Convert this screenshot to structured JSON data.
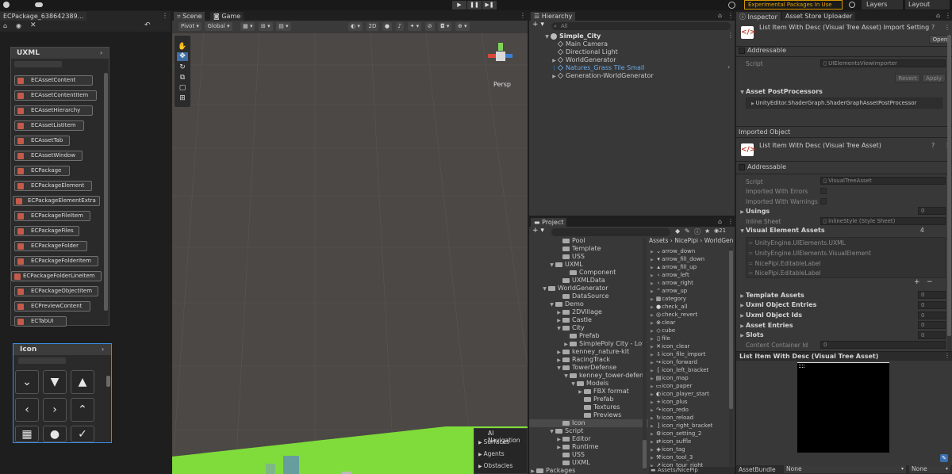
{
  "topbar": {
    "account_label": "",
    "play_icon": "play-icon",
    "pause_icon": "pause-icon",
    "step_icon": "step-icon",
    "experimental_label": "Experimental Packages In Use",
    "layers_label": "Layers",
    "layout_label": "Layout"
  },
  "left_window": {
    "tab_title": "ECPackage_638642389...",
    "uxml": {
      "title": "UXML",
      "items": [
        "ECAssetContent",
        "ECAssetContentItem",
        "ECAssetHierarchy",
        "ECAssetListItem",
        "ECAssetTab",
        "ECAssetWindow",
        "ECPackage",
        "ECPackageElement",
        "ECPackageElementExtra",
        "ECPackageFileItem",
        "ECPackageFiles",
        "ECPackageFolder",
        "ECPackageFolderItem",
        "ECPackageFolderLineItem",
        "ECPackageObjectItem",
        "ECPreviewContent",
        "ECTabUI"
      ]
    },
    "icon": {
      "title": "Icon",
      "buttons": [
        "chevron-down-icon",
        "triangle-down-icon",
        "triangle-up-icon",
        "chevron-left-icon",
        "chevron-right-icon",
        "chevron-up-icon",
        "grid-icon",
        "check-circle-filled-icon",
        "check-circle-outline-icon"
      ]
    }
  },
  "scene": {
    "tabs": [
      "Scene",
      "Game"
    ],
    "toolbar": {
      "pivot": "Pivot",
      "global": "Global",
      "mode_2d": "2D"
    },
    "persp_label": "Persp",
    "ai_nav": {
      "title": "AI Navigation",
      "items": [
        "Surfaces",
        "Agents",
        "Obstacles"
      ]
    }
  },
  "hierarchy": {
    "tab": "Hierarchy",
    "search_placeholder": "All",
    "scene_name": "Simple_City",
    "items": [
      "Main Camera",
      "Directional Light",
      "WorldGenerator",
      "Natures_Grass Tile Small",
      "Generation-WorldGenerator"
    ]
  },
  "project": {
    "tab": "Project",
    "count": "21",
    "breadcrumb": [
      "Assets",
      "NicePipi",
      "WorldGen"
    ],
    "tree": [
      "Pool",
      "Template",
      "USS",
      "UXML",
      "Component",
      "UXMLData",
      "WorldGenerator",
      "DataSource",
      "Demo",
      "2DVillage",
      "Castle",
      "City",
      "Prefab",
      "SimplePoly City - Low",
      "kenney_nature-kit",
      "RacingTrack",
      "TowerDefense",
      "kenney_tower-defens",
      "Models",
      "FBX format",
      "Prefab",
      "Textures",
      "Previews",
      "Icon",
      "Script",
      "Editor",
      "Runtime",
      "USS",
      "UXML",
      "Packages"
    ],
    "files": [
      "arrow_down",
      "arrow_fill_down",
      "arrow_fill_up",
      "arrow_left",
      "arrow_right",
      "arrow_up",
      "category",
      "check_all",
      "check_revert",
      "clear",
      "cube",
      "file",
      "icon_clear",
      "icon_file_import",
      "icon_forward",
      "icon_left_bracket",
      "icon_map",
      "icon_paper",
      "icon_player_start",
      "icon_plus",
      "icon_redo",
      "icon_reload",
      "icon_right_bracket",
      "icon_setting_2",
      "icon_suffle",
      "icon_tag",
      "icon_tool_3",
      "icon_tour_right"
    ],
    "footer_path": "Assets/NicePip"
  },
  "inspector": {
    "tabs": [
      "Inspector",
      "Asset Store Uploader"
    ],
    "header_title": "List Item With Desc (Visual Tree Asset) Import Setting",
    "open_label": "Open",
    "addressable": "Addressable",
    "script_label": "Script",
    "script_value": "UIElementsViewImporter",
    "revert": "Revert",
    "apply": "Apply",
    "postprocessors_title": "Asset PostProcessors",
    "postprocessor_item": "UnityEditor.ShaderGraph.ShaderGraphAssetPostProcessor",
    "imported_object": "Imported Object",
    "object_title": "List Item With Desc (Visual Tree Asset)",
    "addressable2": "Addressable",
    "script2_label": "Script",
    "script2_value": "VisualTreeAsset",
    "imported_errors": "Imported With Errors",
    "imported_warnings": "Imported With Warnings",
    "usings": "Usings",
    "usings_count": "0",
    "inline_sheet": "Inline Sheet",
    "inline_sheet_value": "inlineStyle (Style Sheet)",
    "vea_title": "Visual Element Assets",
    "vea_count": "4",
    "vea_items": [
      "UnityEngine.UIElements.UXML",
      "UnityEngine.UIElements.VisualElement",
      "NicePipi.EditableLabel",
      "NicePipi.EditableLabel"
    ],
    "sections": [
      {
        "label": "Template Assets",
        "count": "0"
      },
      {
        "label": "Uxml Object Entries",
        "count": "0"
      },
      {
        "label": "Uxml Object Ids",
        "count": "0"
      },
      {
        "label": "Asset Entries",
        "count": "0"
      },
      {
        "label": "Slots",
        "count": "0"
      }
    ],
    "content_container_label": "Content Container Id",
    "content_container_value": "0",
    "preview_title": "List Item With Desc (Visual Tree Asset)",
    "assetbundle_label": "AssetBundle",
    "assetbundle_value": "None",
    "assetbundle_variant": "None"
  }
}
